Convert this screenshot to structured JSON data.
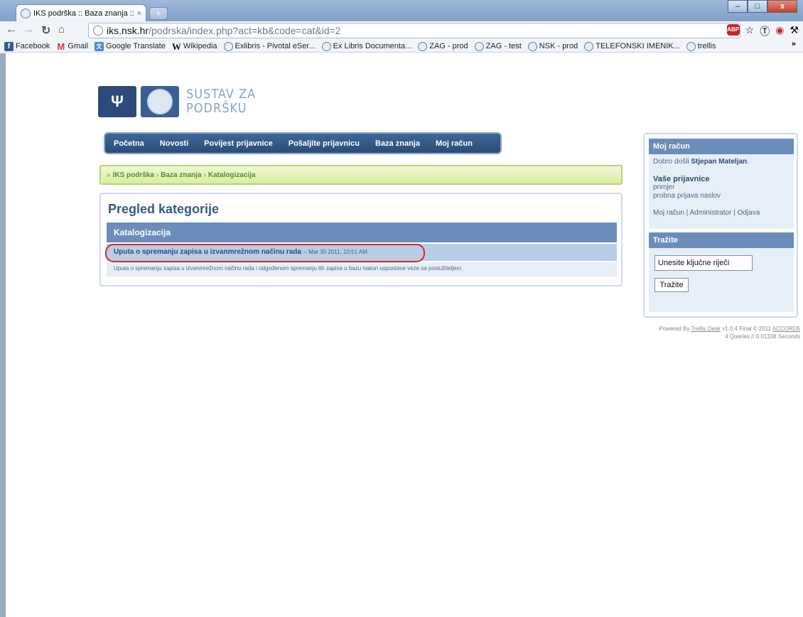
{
  "browser": {
    "tab_title": "IKS podrška :: Baza znanja ::",
    "tab_close": "×",
    "new_tab": "+",
    "window": {
      "minimize": "–",
      "maximize": "□",
      "close": "x"
    },
    "url_host": "iks.nsk.hr",
    "url_path": "/podrska/index.php?act=kb&code=cat&id=2",
    "abp_label": "ABP",
    "bookmarks": [
      {
        "label": "Facebook",
        "icon": "facebook-icon"
      },
      {
        "label": "Gmail",
        "icon": "gmail-icon"
      },
      {
        "label": "Google Translate",
        "icon": "google-translate-icon"
      },
      {
        "label": "Wikipedia",
        "icon": "wikipedia-icon"
      },
      {
        "label": "Exlibris - Pivotal eSer...",
        "icon": "globe-icon"
      },
      {
        "label": "Ex Libris Documenta...",
        "icon": "globe-icon"
      },
      {
        "label": "ZAG - prod",
        "icon": "globe-icon"
      },
      {
        "label": "ZAG - test",
        "icon": "globe-icon"
      },
      {
        "label": "NSK - prod",
        "icon": "globe-icon"
      },
      {
        "label": "TELEFONSKI IMENIK...",
        "icon": "globe-icon"
      },
      {
        "label": "trellis",
        "icon": "globe-icon"
      }
    ],
    "bookmarks_overflow": "»"
  },
  "header": {
    "logo_line1": "SUSTAV ZA",
    "logo_line2": "PODRŠKU"
  },
  "nav": [
    "Početna",
    "Novosti",
    "Povijest prijavnice",
    "Pošaljite prijavnicu",
    "Baza znanja",
    "Moj račun"
  ],
  "breadcrumb": [
    "IKS podrška",
    "Baza znanja",
    "Katalogizacija"
  ],
  "main": {
    "title": "Pregled kategorije",
    "category": "Katalogizacija",
    "article": {
      "title": "Uputa o spremanju zapisa u izvanmrežnom načinu rada",
      "meta": "-- Mar 30 2011, 10:51 AM",
      "description": "Uputa o spremanju zapisa u izvanmrežnom načinu rada i odgođenom spremanju tih zapisa u bazu nakon uspostave veze sa poslužiteljem"
    }
  },
  "sidebar": {
    "account_title": "Moj račun",
    "welcome_prefix": "Dobro došli",
    "user_name": "Stjepan Mateljan",
    "welcome_suffix": ".",
    "tickets_title": "Vaše prijavnice",
    "tickets": [
      "primjer",
      "probna prijava naslov"
    ],
    "links": "Moj račun | Administrator | Odjava",
    "search_title": "Tražite",
    "search_value": "Unesite ključne riječi",
    "search_button": "Tražite"
  },
  "footer": {
    "powered_prefix": "Powered By",
    "powered_link": "Trellis Desk",
    "version": "v1.0.4 Final © 2011",
    "company": "ACCORD5",
    "stats": "4 Queries // 0.01338 Seconds"
  }
}
